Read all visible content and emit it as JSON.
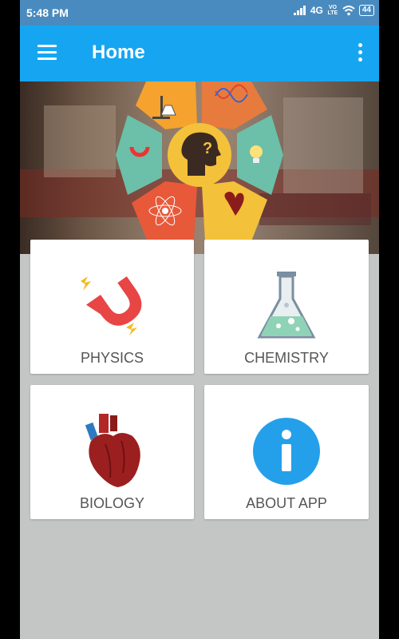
{
  "status_bar": {
    "time": "5:48 PM",
    "network": "4G",
    "volte": "VO LTE",
    "battery": "44"
  },
  "toolbar": {
    "title": "Home",
    "menu_icon": "hamburger-menu-icon",
    "overflow_icon": "more-vert-icon"
  },
  "banner": {
    "icons": [
      "lab-stand-flask-icon",
      "dna-icon",
      "bulb-icon",
      "heart-icon",
      "atom-icon",
      "magnet-icon",
      "head-question-icon"
    ],
    "colors": {
      "orange": "#f5a22e",
      "teal": "#6cbfa9",
      "red_orange": "#e8593a",
      "yellow": "#f4c13a",
      "dark_orange": "#e77b3e"
    }
  },
  "categories": [
    {
      "label": "PHYSICS",
      "icon": "magnet-icon"
    },
    {
      "label": "CHEMISTRY",
      "icon": "flask-icon"
    },
    {
      "label": "BIOLOGY",
      "icon": "heart-icon"
    },
    {
      "label": "ABOUT APP",
      "icon": "info-icon"
    }
  ],
  "colors": {
    "status_bar": "#4a8bbf",
    "toolbar": "#16a6f1",
    "background": "#c4c6c6",
    "card": "#ffffff",
    "label_text": "#555555"
  }
}
